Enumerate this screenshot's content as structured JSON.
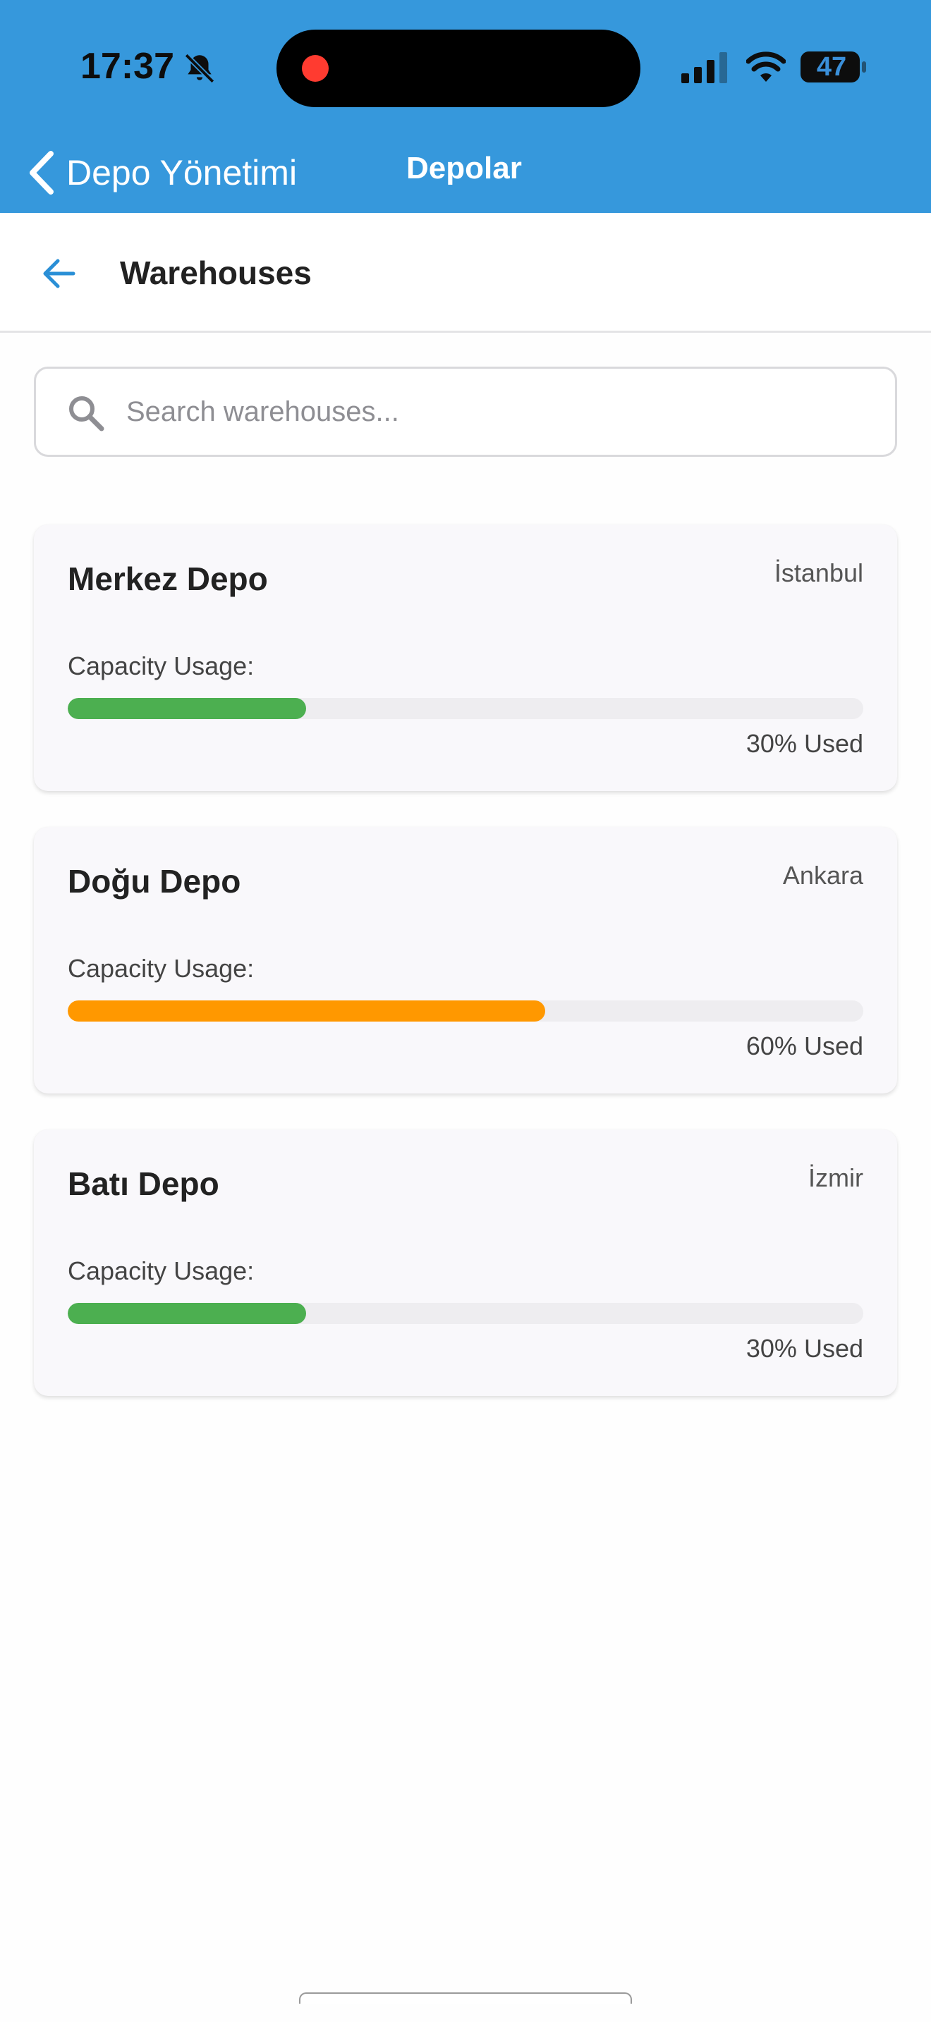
{
  "status_bar": {
    "time": "17:37",
    "battery": "47",
    "icons": [
      "bell-slash-icon",
      "signal-icon",
      "wifi-icon",
      "battery-icon"
    ],
    "recording_indicator": "#ff3b30"
  },
  "nav_bar": {
    "back_label": "Depo Yönetimi",
    "title": "Depolar",
    "background": "#3698dc"
  },
  "header": {
    "title": "Warehouses",
    "back_icon": "arrow-left-icon",
    "accent": "#2a8fd6"
  },
  "search": {
    "placeholder": "Search warehouses...",
    "value": ""
  },
  "warehouses": [
    {
      "name": "Merkez Depo",
      "city": "İstanbul",
      "capacity_label": "Capacity Usage:",
      "usage_percent": 30,
      "usage_text": "30% Used",
      "bar_color": "#4caf50"
    },
    {
      "name": "Doğu Depo",
      "city": "Ankara",
      "capacity_label": "Capacity Usage:",
      "usage_percent": 60,
      "usage_text": "60% Used",
      "bar_color": "#ff9800"
    },
    {
      "name": "Batı Depo",
      "city": "İzmir",
      "capacity_label": "Capacity Usage:",
      "usage_percent": 30,
      "usage_text": "30% Used",
      "bar_color": "#4caf50"
    }
  ]
}
